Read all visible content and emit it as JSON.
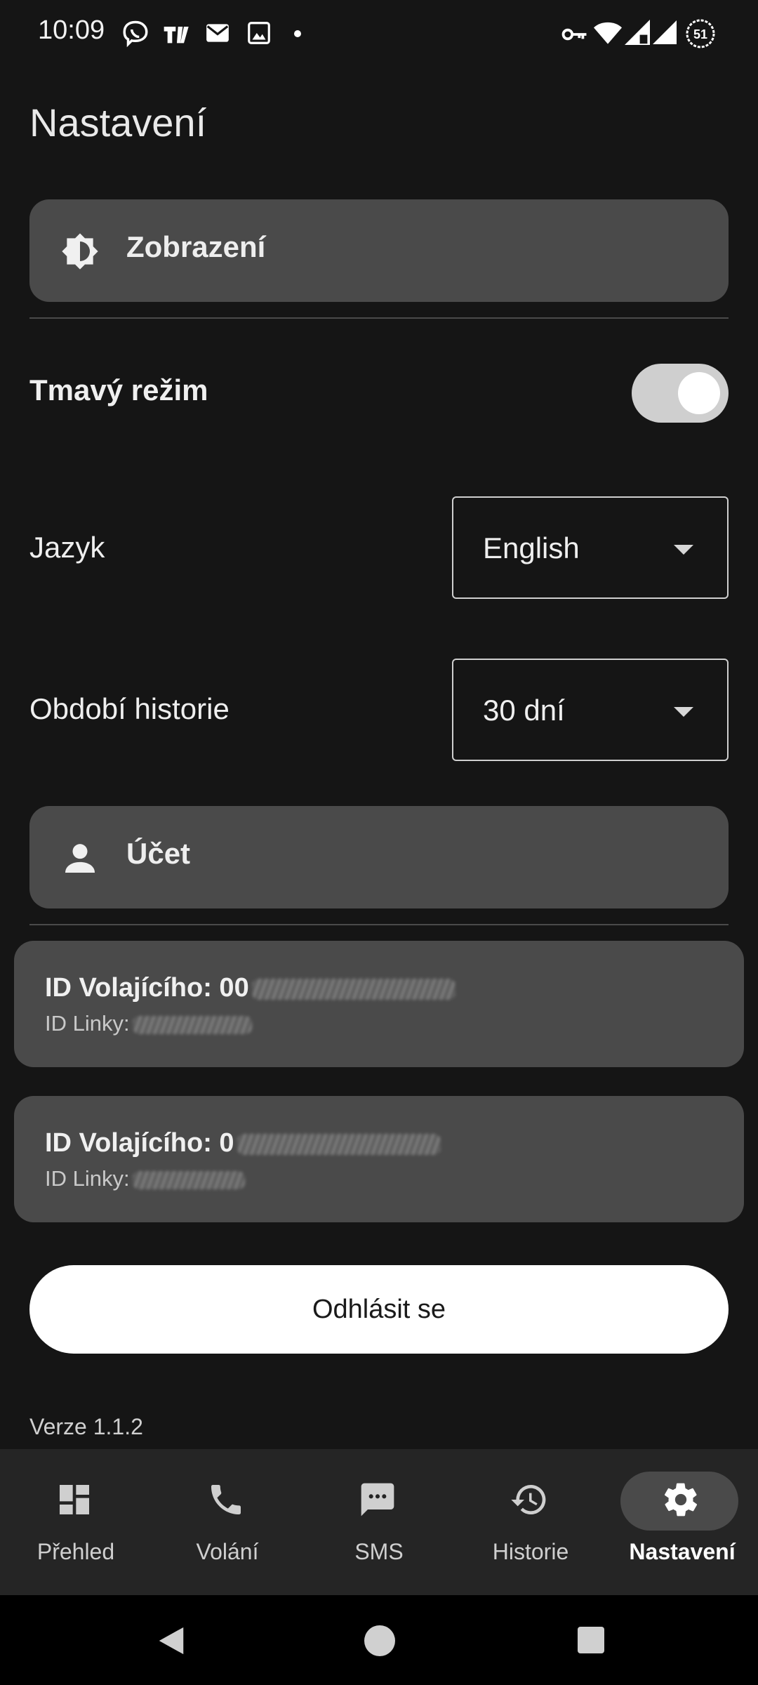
{
  "status_bar": {
    "time": "10:09",
    "left_icons": [
      "viber-icon",
      "tradingview-icon",
      "mail-icon",
      "image-icon",
      "dot-icon"
    ],
    "right_icons": [
      "vpn-key-icon",
      "wifi-icon",
      "signal-icon",
      "signal-icon",
      "battery-icon"
    ],
    "battery": "51"
  },
  "header": {
    "title": "Nastavení"
  },
  "display_section": {
    "icon": "brightness-icon",
    "label": "Zobrazení"
  },
  "dark_mode": {
    "label": "Tmavý režim",
    "enabled": true
  },
  "language": {
    "label": "Jazyk",
    "value": "English"
  },
  "history_period": {
    "label": "Období historie",
    "value": "30 dní"
  },
  "account_section": {
    "icon": "person-icon",
    "label": "Účet"
  },
  "accounts": [
    {
      "caller_id_label": "ID Volajícího: 00",
      "line_id_label": "ID Linky:"
    },
    {
      "caller_id_label": "ID Volajícího: 0",
      "line_id_label": "ID Linky:"
    }
  ],
  "logout": {
    "label": "Odhlásit se"
  },
  "version": "Verze 1.1.2",
  "bottom_nav": [
    {
      "label": "Přehled",
      "icon": "dashboard-icon",
      "active": false
    },
    {
      "label": "Volání",
      "icon": "phone-icon",
      "active": false
    },
    {
      "label": "SMS",
      "icon": "sms-icon",
      "active": false
    },
    {
      "label": "Historie",
      "icon": "history-icon",
      "active": false
    },
    {
      "label": "Nastavení",
      "icon": "settings-icon",
      "active": true
    }
  ],
  "system_nav": [
    "back-icon",
    "home-icon",
    "recents-icon"
  ],
  "colors": {
    "background": "#151515",
    "card": "#4a4a4a",
    "nav_background": "#252525",
    "toggle_track": "#cfcfcf",
    "logout_background": "#ffffff"
  }
}
